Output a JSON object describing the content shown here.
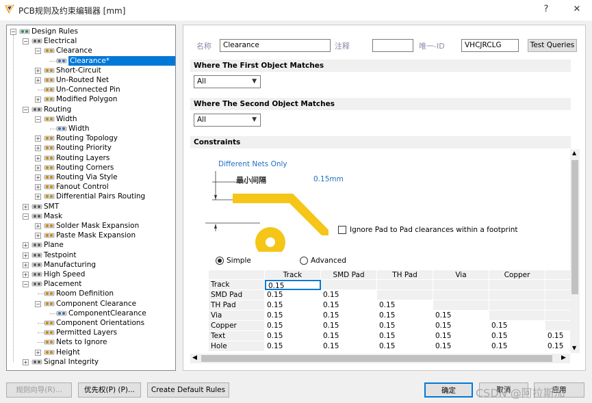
{
  "window": {
    "title": "PCB规则及约束编辑器 [mm]",
    "help_label": "?",
    "close_label": "✕"
  },
  "tree": [
    {
      "label": "Design Rules",
      "depth": 0,
      "expander": "−",
      "icon": "design-rules-icon"
    },
    {
      "label": "Electrical",
      "depth": 1,
      "expander": "−",
      "icon": "electrical-icon"
    },
    {
      "label": "Clearance",
      "depth": 2,
      "expander": "−",
      "icon": "clearance-icon"
    },
    {
      "label": "Clearance*",
      "depth": 3,
      "expander": "",
      "icon": "clearance-rule-icon",
      "selected": true
    },
    {
      "label": "Short-Circuit",
      "depth": 2,
      "expander": "+",
      "icon": "short-circuit-icon"
    },
    {
      "label": "Un-Routed Net",
      "depth": 2,
      "expander": "+",
      "icon": "unrouted-net-icon"
    },
    {
      "label": "Un-Connected Pin",
      "depth": 2,
      "expander": "",
      "icon": "unconnected-pin-icon"
    },
    {
      "label": "Modified Polygon",
      "depth": 2,
      "expander": "+",
      "icon": "modified-polygon-icon"
    },
    {
      "label": "Routing",
      "depth": 1,
      "expander": "−",
      "icon": "routing-icon"
    },
    {
      "label": "Width",
      "depth": 2,
      "expander": "−",
      "icon": "width-icon"
    },
    {
      "label": "Width",
      "depth": 3,
      "expander": "",
      "icon": "width-rule-icon"
    },
    {
      "label": "Routing Topology",
      "depth": 2,
      "expander": "+",
      "icon": "routing-topology-icon"
    },
    {
      "label": "Routing Priority",
      "depth": 2,
      "expander": "+",
      "icon": "routing-priority-icon"
    },
    {
      "label": "Routing Layers",
      "depth": 2,
      "expander": "+",
      "icon": "routing-layers-icon"
    },
    {
      "label": "Routing Corners",
      "depth": 2,
      "expander": "+",
      "icon": "routing-corners-icon"
    },
    {
      "label": "Routing Via Style",
      "depth": 2,
      "expander": "+",
      "icon": "routing-via-style-icon"
    },
    {
      "label": "Fanout Control",
      "depth": 2,
      "expander": "+",
      "icon": "fanout-control-icon"
    },
    {
      "label": "Differential Pairs Routing",
      "depth": 2,
      "expander": "+",
      "icon": "differential-pairs-icon"
    },
    {
      "label": "SMT",
      "depth": 1,
      "expander": "+",
      "icon": "smt-icon"
    },
    {
      "label": "Mask",
      "depth": 1,
      "expander": "−",
      "icon": "mask-icon"
    },
    {
      "label": "Solder Mask Expansion",
      "depth": 2,
      "expander": "+",
      "icon": "solder-mask-icon"
    },
    {
      "label": "Paste Mask Expansion",
      "depth": 2,
      "expander": "+",
      "icon": "paste-mask-icon"
    },
    {
      "label": "Plane",
      "depth": 1,
      "expander": "+",
      "icon": "plane-icon"
    },
    {
      "label": "Testpoint",
      "depth": 1,
      "expander": "+",
      "icon": "testpoint-icon"
    },
    {
      "label": "Manufacturing",
      "depth": 1,
      "expander": "+",
      "icon": "manufacturing-icon"
    },
    {
      "label": "High Speed",
      "depth": 1,
      "expander": "+",
      "icon": "high-speed-icon"
    },
    {
      "label": "Placement",
      "depth": 1,
      "expander": "−",
      "icon": "placement-icon"
    },
    {
      "label": "Room Definition",
      "depth": 2,
      "expander": "",
      "icon": "room-definition-icon"
    },
    {
      "label": "Component Clearance",
      "depth": 2,
      "expander": "−",
      "icon": "component-clearance-icon"
    },
    {
      "label": "ComponentClearance",
      "depth": 3,
      "expander": "",
      "icon": "component-clearance-rule-icon"
    },
    {
      "label": "Component Orientations",
      "depth": 2,
      "expander": "",
      "icon": "component-orientations-icon"
    },
    {
      "label": "Permitted Layers",
      "depth": 2,
      "expander": "",
      "icon": "permitted-layers-icon"
    },
    {
      "label": "Nets to Ignore",
      "depth": 2,
      "expander": "",
      "icon": "nets-to-ignore-icon"
    },
    {
      "label": "Height",
      "depth": 2,
      "expander": "+",
      "icon": "height-icon"
    },
    {
      "label": "Signal Integrity",
      "depth": 1,
      "expander": "+",
      "icon": "signal-integrity-icon"
    }
  ],
  "rule": {
    "name_label": "名称",
    "name_value": "Clearance",
    "comment_label": "注释",
    "comment_value": "",
    "uid_label": "唯一-ID",
    "uid_value": "VHCJRCLG",
    "test_queries_label": "Test Queries"
  },
  "first_match": {
    "header": "Where The First Object Matches",
    "value": "All"
  },
  "second_match": {
    "header": "Where The Second Object Matches",
    "value": "All"
  },
  "constraints": {
    "header": "Constraints",
    "different_nets_label": "Different Nets Only",
    "min_clearance_label": "最小间隔",
    "min_clearance_value": "0.15mm",
    "ignore_pad_label": "Ignore Pad to Pad clearances within a footprint",
    "ignore_pad_checked": false,
    "mode_simple_label": "Simple",
    "mode_advanced_label": "Advanced",
    "mode_selected": "Simple",
    "columns": [
      "Track",
      "SMD Pad",
      "TH Pad",
      "Via",
      "Copper"
    ],
    "rows": [
      {
        "label": "Track",
        "values": [
          "0.15",
          "",
          "",
          "",
          "",
          ""
        ]
      },
      {
        "label": "SMD Pad",
        "values": [
          "0.15",
          "0.15",
          "",
          "",
          "",
          ""
        ]
      },
      {
        "label": "TH Pad",
        "values": [
          "0.15",
          "0.15",
          "0.15",
          "",
          "",
          ""
        ]
      },
      {
        "label": "Via",
        "values": [
          "0.15",
          "0.15",
          "0.15",
          "0.15",
          "",
          ""
        ]
      },
      {
        "label": "Copper",
        "values": [
          "0.15",
          "0.15",
          "0.15",
          "0.15",
          "0.15",
          ""
        ]
      },
      {
        "label": "Text",
        "values": [
          "0.15",
          "0.15",
          "0.15",
          "0.15",
          "0.15",
          "0.15"
        ]
      },
      {
        "label": "Hole",
        "values": [
          "0.15",
          "0.15",
          "0.15",
          "0.15",
          "0.15",
          "0.15"
        ]
      }
    ]
  },
  "bottom": {
    "rule_wizard_label": "规则向导(R)...",
    "priority_label": "优先权(P) (P)...",
    "create_default_label": "Create Default Rules",
    "ok_label": "确定",
    "cancel_label": "取消",
    "apply_label": "应用"
  },
  "watermark": "CSDN @阿拉斯加",
  "colors": {
    "selection": "#0078d7",
    "copper": "#f5c518",
    "dim_text": "#1f6fbf"
  }
}
